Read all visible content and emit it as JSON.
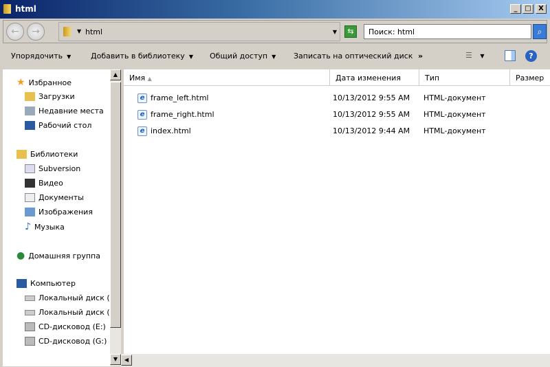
{
  "window": {
    "title": "html",
    "min": "_",
    "max": "□",
    "close": "X"
  },
  "address": {
    "path": "html",
    "search_placeholder": "Поиск: html"
  },
  "toolbar": {
    "organize": "Упорядочить",
    "add_library": "Добавить в библиотеку",
    "share": "Общий доступ",
    "burn": "Записать на оптический диск",
    "more": "»",
    "help": "?"
  },
  "sidebar": {
    "favorites": {
      "label": "Избранное",
      "items": [
        "Загрузки",
        "Недавние места",
        "Рабочий стол"
      ]
    },
    "libraries": {
      "label": "Библиотеки",
      "items": [
        "Subversion",
        "Видео",
        "Документы",
        "Изображения",
        "Музыка"
      ]
    },
    "homegroup": "Домашняя группа",
    "computer": {
      "label": "Компьютер",
      "items": [
        "Локальный диск (",
        "Локальный диск (",
        "CD-дисковод (E:)",
        "CD-дисковод (G:)"
      ]
    }
  },
  "columns": {
    "name": "Имя",
    "date": "Дата изменения",
    "type": "Тип",
    "size": "Размер"
  },
  "files": [
    {
      "name": "frame_left.html",
      "date": "10/13/2012 9:55 AM",
      "type": "HTML-документ"
    },
    {
      "name": "frame_right.html",
      "date": "10/13/2012 9:55 AM",
      "type": "HTML-документ"
    },
    {
      "name": "index.html",
      "date": "10/13/2012 9:44 AM",
      "type": "HTML-документ"
    }
  ]
}
